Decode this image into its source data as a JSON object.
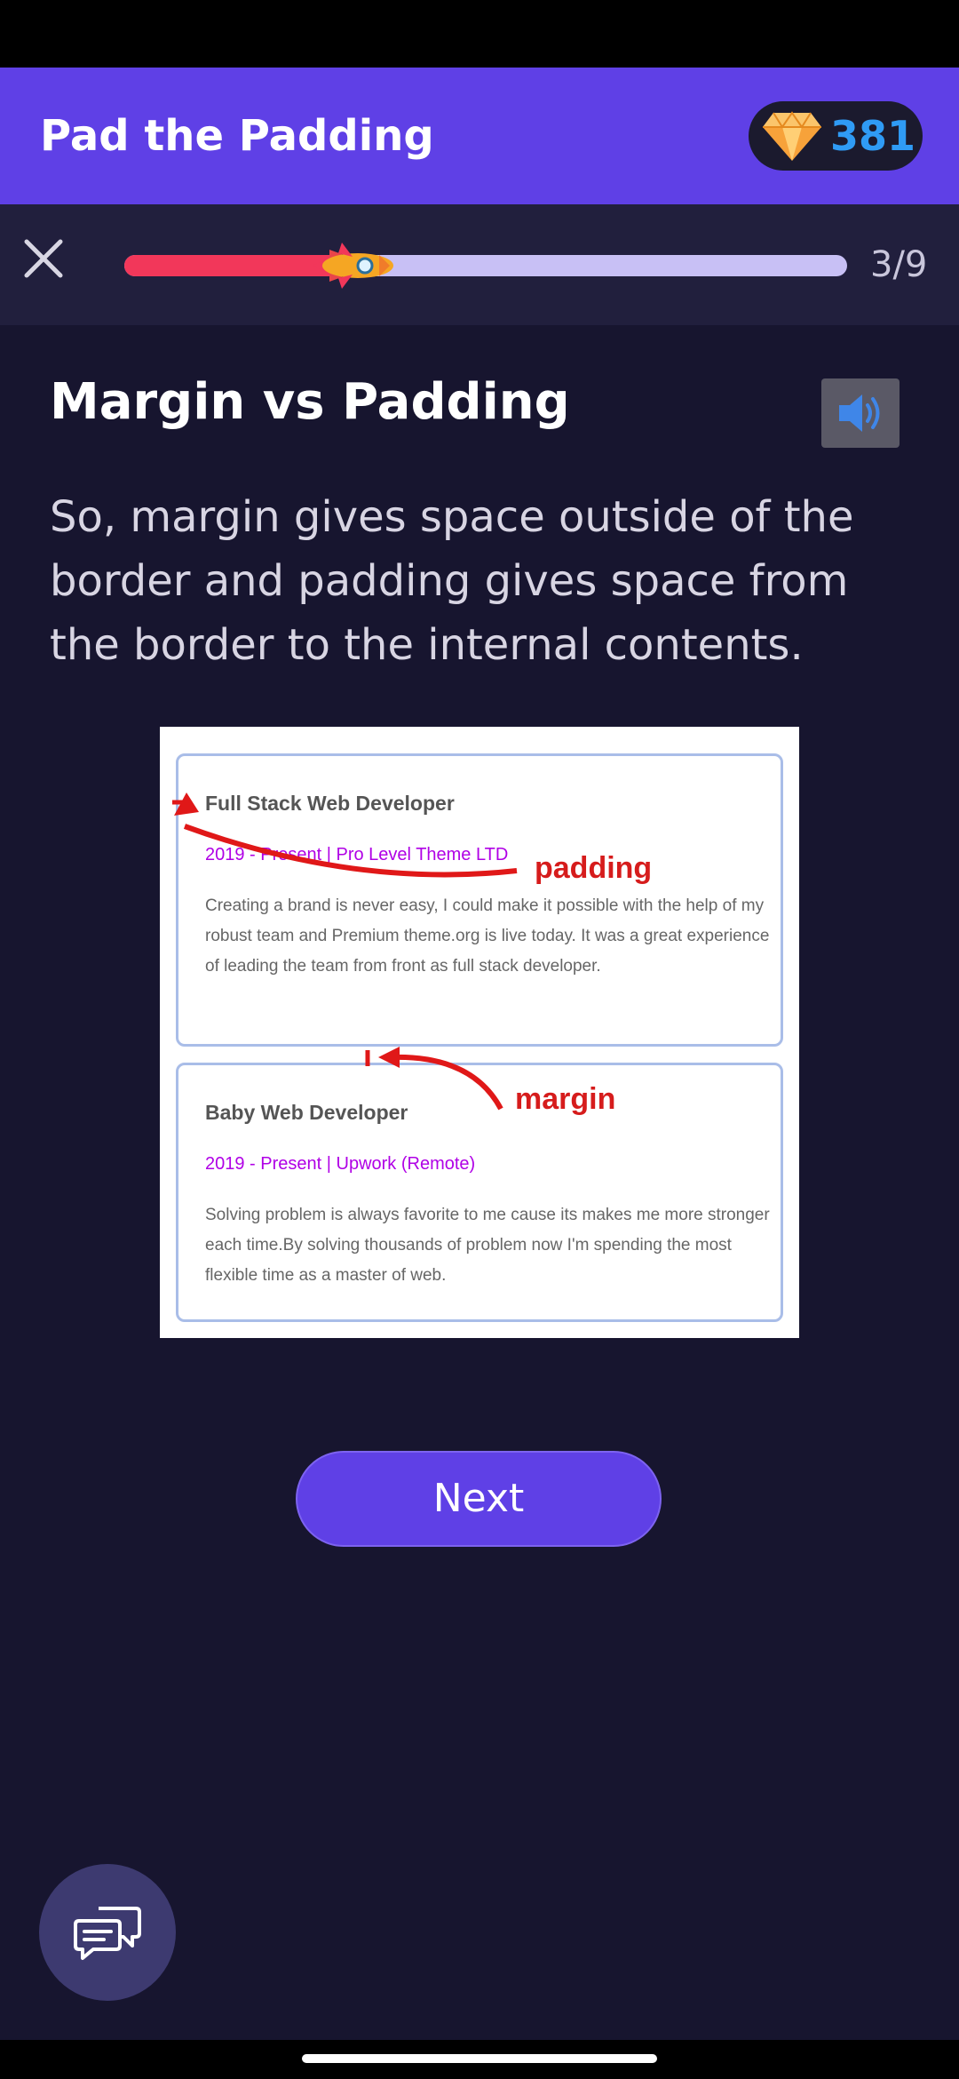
{
  "header": {
    "title": "Pad the Padding",
    "gems": "381"
  },
  "progress": {
    "current": 3,
    "total": 9,
    "text": "3/9",
    "fraction": 0.333
  },
  "lesson": {
    "title": "Margin vs Padding",
    "body": "So, margin gives space outside of the border and padding gives space from the border to the internal contents."
  },
  "illustration": {
    "card1": {
      "title": "Full Stack Web Developer",
      "subtitle": "2019 - Present | Pro Level Theme LTD",
      "text": "Creating a brand is never easy, I could make it possible with the help of my robust team and Premium theme.org is live today. It was a great experience of leading the team from front as full stack developer."
    },
    "card2": {
      "title": "Baby Web Developer",
      "subtitle": "2019 - Present | Upwork (Remote)",
      "text": "Solving problem is always favorite to me cause its makes me more stronger each time.By solving thousands of problem now I'm spending the most flexible time as a master of web."
    },
    "annotations": {
      "padding": "padding",
      "margin": "margin"
    }
  },
  "buttons": {
    "next": "Next"
  },
  "icons": {
    "close": "close-icon",
    "gem": "diamond-icon",
    "audio": "speaker-icon",
    "chat": "chat-bubbles-icon",
    "rocket": "rocket-icon"
  },
  "colors": {
    "accent": "#5f40e6",
    "background": "#17152f",
    "progress_fill": "#f2375a",
    "progress_track": "#c8c0f5",
    "gem_count": "#2f9bf5"
  }
}
